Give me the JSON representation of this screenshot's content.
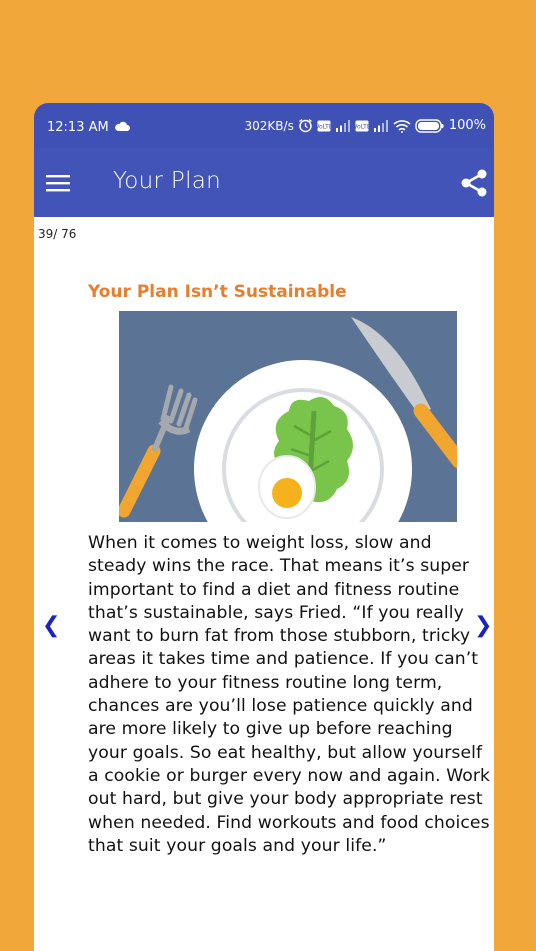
{
  "status_bar": {
    "time": "12:13 AM",
    "speed": "302KB/s",
    "battery": "100%",
    "icons": [
      "cloud-icon",
      "alarm-icon",
      "volte-icon",
      "signal-icon",
      "wifi-icon",
      "battery-icon"
    ]
  },
  "app_bar": {
    "title": "Your Plan",
    "icons": [
      "menu-icon",
      "share-icon"
    ]
  },
  "page_counter": "39/ 76",
  "article": {
    "title": "Your Plan Isn’t Sustainable",
    "image_icons": [
      "plate-illustration"
    ],
    "body": "When it comes to weight loss, slow and steady wins the race. That means it’s super important to find a diet and fitness routine that’s sustainable, says Fried. “If you really want to burn fat from those stubborn, tricky areas it takes time and patience. If you can’t adhere to your fitness routine long term, chances are you’ll lose patience quickly and are more likely to give up before reaching your goals. So eat healthy, but allow yourself a cookie or burger every now and again. Work out hard, but give your body appropriate rest when needed. Find workouts and food choices that suit your goals and your life.”"
  },
  "nav": {
    "prev": "❮",
    "next": "❯"
  },
  "colors": {
    "background": "#f2a73b",
    "app_bar": "#4254b8",
    "title": "#e87e2d",
    "nav_arrows": "#1a22c6"
  }
}
